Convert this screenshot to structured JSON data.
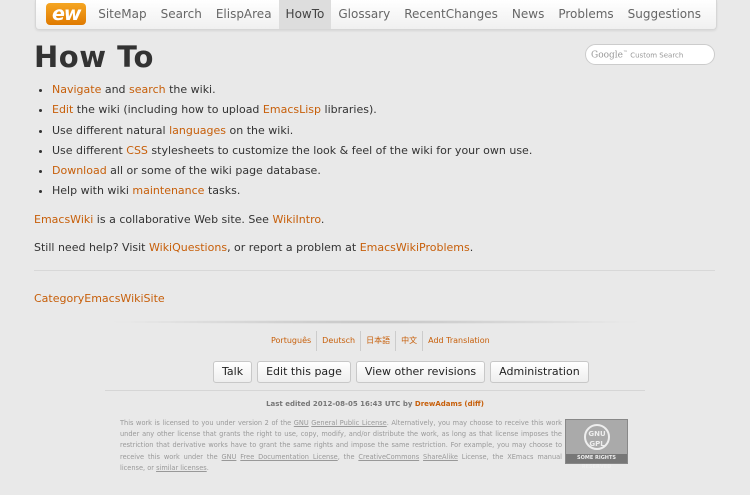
{
  "header": {
    "logo": "ew",
    "nav": [
      {
        "label": "SiteMap",
        "active": false
      },
      {
        "label": "Search",
        "active": false
      },
      {
        "label": "ElispArea",
        "active": false
      },
      {
        "label": "HowTo",
        "active": true
      },
      {
        "label": "Glossary",
        "active": false
      },
      {
        "label": "RecentChanges",
        "active": false
      },
      {
        "label": "News",
        "active": false
      },
      {
        "label": "Problems",
        "active": false
      },
      {
        "label": "Suggestions",
        "active": false
      }
    ]
  },
  "search": {
    "google_text": "Google",
    "tm": "™",
    "placeholder_text": "Custom Search"
  },
  "page": {
    "title": "How To",
    "tasks": [
      {
        "link1": "Navigate",
        "text1": " and ",
        "link2": "search",
        "text2": " the wiki."
      },
      {
        "link1": "Edit",
        "text1": " the wiki (including how to upload ",
        "link2": "EmacsLisp",
        "text2": " libraries)."
      },
      {
        "pre": "Use different natural ",
        "link": "languages",
        "post": " on the wiki."
      },
      {
        "pre": "Use different ",
        "link": "CSS",
        "post": " stylesheets to customize the look & feel of the wiki for your own use."
      },
      {
        "link": "Download",
        "post": " all or some of the wiki page database."
      },
      {
        "pre": "Help with wiki ",
        "link": "maintenance",
        "post": " tasks."
      }
    ],
    "para1": {
      "link1": "EmacsWiki",
      "text1": " is a collaborative Web site. See ",
      "link2": "WikiIntro",
      "text2": "."
    },
    "para2": {
      "text1": "Still need help? Visit ",
      "link1": "WikiQuestions",
      "text2": ", or report a problem at ",
      "link2": "EmacsWikiProblems",
      "text3": "."
    },
    "category": "CategoryEmacsWikiSite"
  },
  "footer": {
    "translations": [
      "Português",
      "Deutsch",
      "日本語",
      "中文",
      "Add Translation"
    ],
    "buttons": [
      "Talk",
      "Edit this page",
      "View other revisions",
      "Administration"
    ],
    "edited": {
      "prefix": "Last edited 2012-08-05 16:43 UTC by ",
      "author": "DrewAdams",
      "diff": "(diff)"
    },
    "license": {
      "t1": "This work is licensed to you under version 2 of the ",
      "l1": "GNU",
      "t2": " ",
      "l2": "General Public License",
      "t3": ". Alternatively, you may choose to receive this work under any other license that grants the right to use, copy, modify, and/or distribute the work, as long as that license imposes the restriction that derivative works have to grant the same rights and impose the same restriction. For example, you may choose to receive this work under the ",
      "l3": "GNU",
      "t4": " ",
      "l4": "Free Documentation License",
      "t5": ", the ",
      "l5": "CreativeCommons",
      "t6": " ",
      "l6": "ShareAlike",
      "t7": " License, the XEmacs manual license, or ",
      "l7": "similar licenses",
      "t8": "."
    },
    "badge": {
      "line1": "GNU",
      "line2": "GPL",
      "bottom": "SOME RIGHTS RESERVED"
    }
  }
}
